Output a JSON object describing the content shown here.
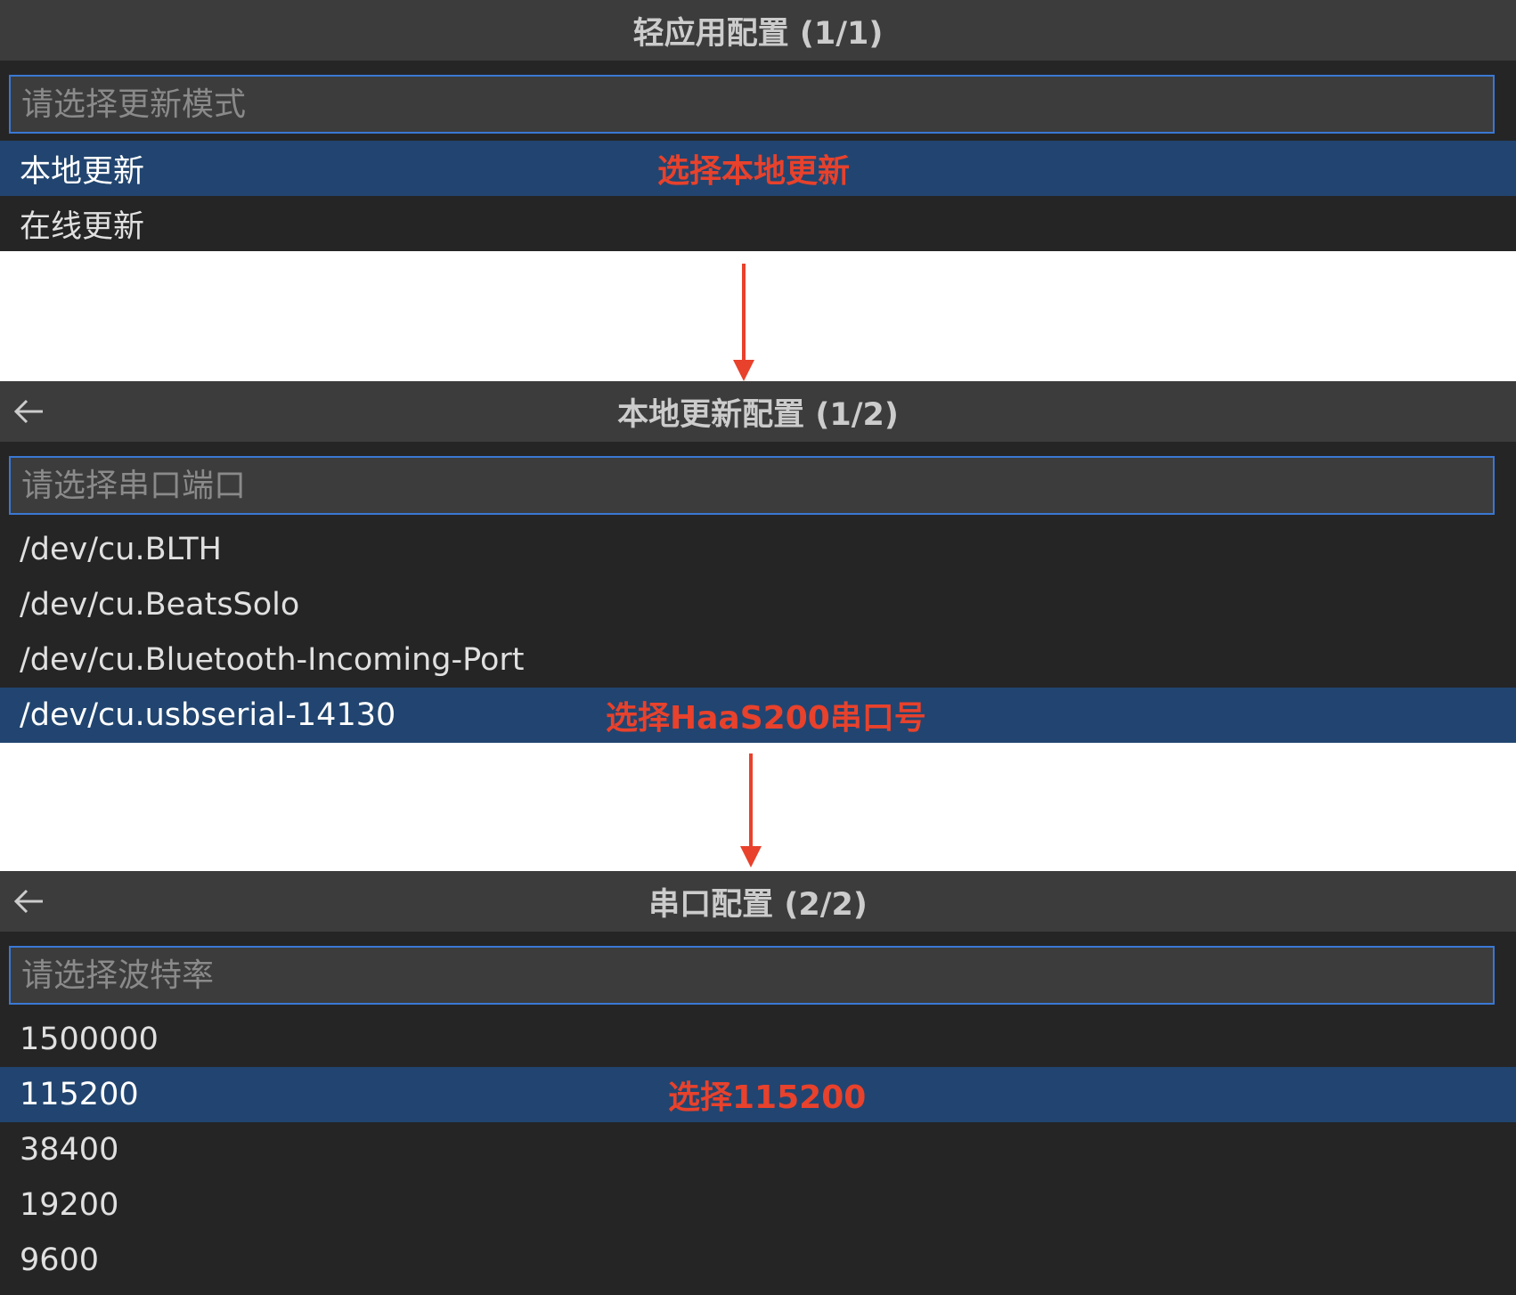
{
  "panels": [
    {
      "title": "轻应用配置 (1/1)",
      "has_back": false,
      "placeholder": "请选择更新模式",
      "items": [
        {
          "label": "本地更新",
          "selected": true,
          "annotation": "选择本地更新"
        },
        {
          "label": "在线更新",
          "selected": false,
          "annotation": ""
        }
      ]
    },
    {
      "title": "本地更新配置 (1/2)",
      "has_back": true,
      "placeholder": "请选择串口端口",
      "items": [
        {
          "label": "/dev/cu.BLTH",
          "selected": false,
          "annotation": ""
        },
        {
          "label": "/dev/cu.BeatsSolo",
          "selected": false,
          "annotation": ""
        },
        {
          "label": "/dev/cu.Bluetooth-Incoming-Port",
          "selected": false,
          "annotation": ""
        },
        {
          "label": "/dev/cu.usbserial-14130",
          "selected": true,
          "annotation": "选择HaaS200串口号"
        }
      ]
    },
    {
      "title": "串口配置 (2/2)",
      "has_back": true,
      "placeholder": "请选择波特率",
      "items": [
        {
          "label": "1500000",
          "selected": false,
          "annotation": ""
        },
        {
          "label": "115200",
          "selected": true,
          "annotation": "选择115200"
        },
        {
          "label": "38400",
          "selected": false,
          "annotation": ""
        },
        {
          "label": "19200",
          "selected": false,
          "annotation": ""
        },
        {
          "label": "9600",
          "selected": false,
          "annotation": ""
        }
      ]
    }
  ],
  "colors": {
    "title_bg": "#3c3c3c",
    "list_bg": "#252526",
    "selected_bg": "#214570",
    "input_border": "#3a78d4",
    "annotation": "#e8412c",
    "arrow": "#e8412c"
  },
  "icons": {
    "back": "arrow-left-icon",
    "flow": "arrow-down-icon"
  }
}
